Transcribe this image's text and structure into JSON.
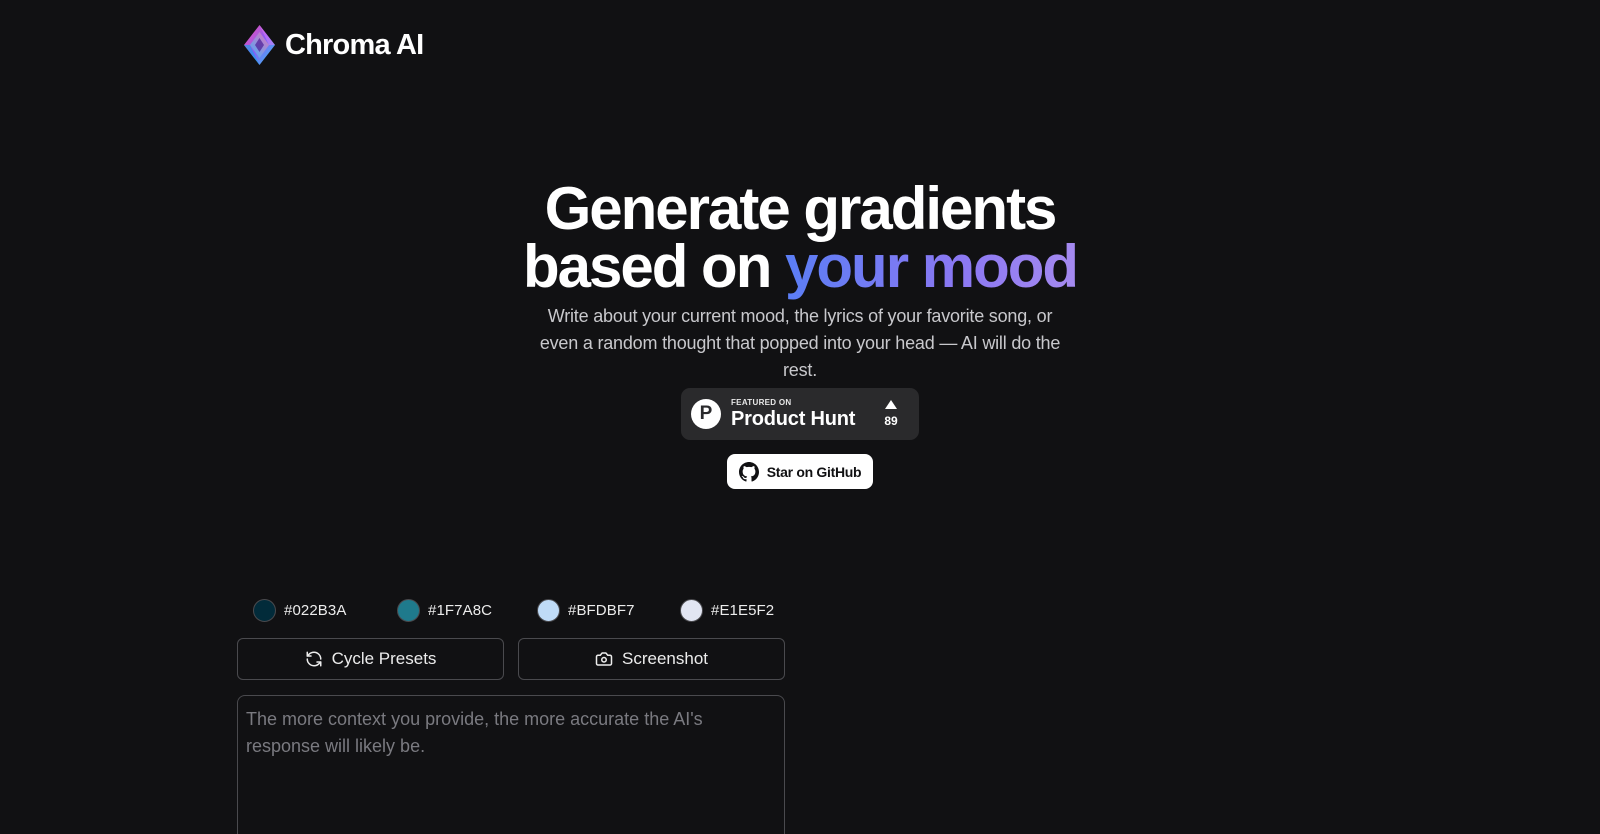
{
  "brand": {
    "name": "Chroma AI",
    "logo_icon": "gem-diamond-icon"
  },
  "hero": {
    "title_line1": "Generate gradients",
    "title_line2_plain": "based on ",
    "title_line2_accent": "your mood",
    "subtitle": "Write about your current mood, the lyrics of your favorite song, or even a random thought that popped into your head — AI will do the rest."
  },
  "product_hunt": {
    "featured_label": "FEATURED ON",
    "name": "Product Hunt",
    "votes": "89",
    "logo_letter": "P"
  },
  "github": {
    "label": "Star on GitHub",
    "icon": "github-icon"
  },
  "palette": [
    {
      "hex": "#022B3A"
    },
    {
      "hex": "#1F7A8C"
    },
    {
      "hex": "#BFDBF7"
    },
    {
      "hex": "#E1E5F2"
    }
  ],
  "actions": {
    "cycle_label": "Cycle Presets",
    "cycle_icon": "refresh-icon",
    "screenshot_label": "Screenshot",
    "screenshot_icon": "camera-icon"
  },
  "prompt": {
    "placeholder": "The more context you provide, the more accurate the AI's response will likely be.",
    "value": ""
  },
  "colors": {
    "background": "#111113",
    "accent_start": "#5b7ef5",
    "accent_end": "#a58af0"
  }
}
